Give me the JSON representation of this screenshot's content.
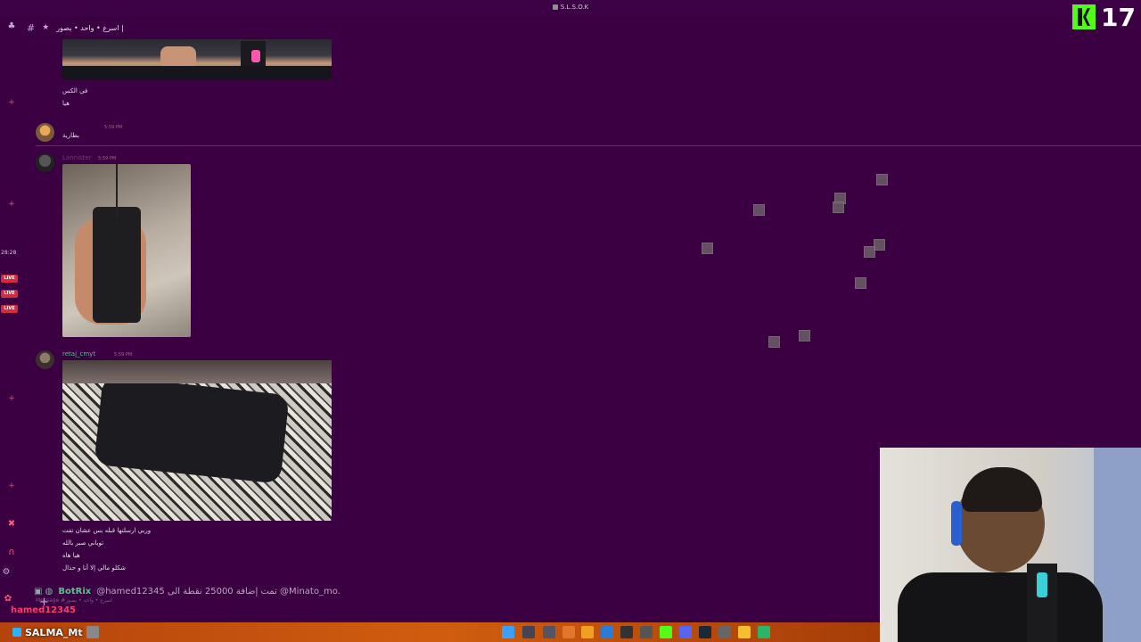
{
  "window": {
    "title": "S.L.S.O.K"
  },
  "overlay": {
    "kick_count": "17"
  },
  "channel": {
    "name": "اسرع • واحد • يصور |"
  },
  "sidebar": {
    "stream_time": "28:28",
    "live_label": "LIVE"
  },
  "messages": [
    {
      "text_lines": [
        "في الكس",
        "هيا"
      ]
    },
    {
      "author": "",
      "time": "5:59 PM",
      "text": "بطارية"
    },
    {
      "author": "Lannister",
      "time": "5:59 PM"
    },
    {
      "author": "retaj_cmyt",
      "time": "5:59 PM",
      "text_lines": [
        "وربي ارسلتها قبله بس عشان تفت",
        "توباني صبر بالله",
        "هيا هاه",
        "شكلو مالي إلا أنا و حذال"
      ]
    }
  ],
  "bot_message": {
    "bot": "BotRix",
    "text": "@hamed12345 تمت إضافة 25000 نقطة الى @Minato_mo."
  },
  "input": {
    "placeholder": "Message #اسرع • واحد • يصور"
  },
  "overlay_chat": {
    "last_user": "hamed12345"
  },
  "streamer": {
    "name": "SALMA_Mt"
  },
  "colors": {
    "background": "#3a0042",
    "accent": "#53fc18",
    "live": "#d42a3e",
    "bot": "#53c58a"
  }
}
